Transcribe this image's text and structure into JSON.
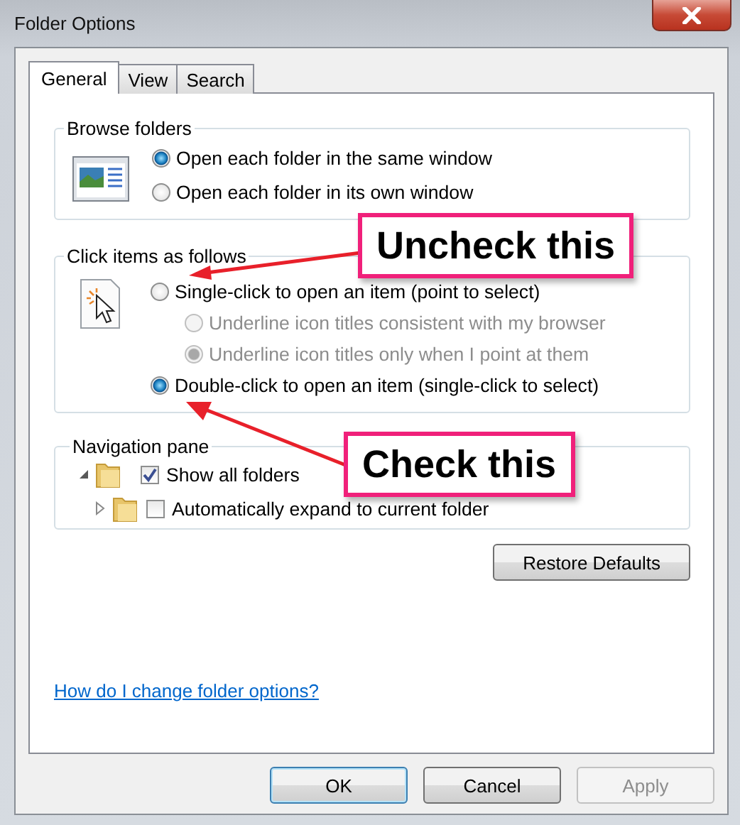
{
  "window": {
    "title": "Folder Options"
  },
  "tabs": [
    {
      "label": "General",
      "selected": true
    },
    {
      "label": "View",
      "selected": false
    },
    {
      "label": "Search",
      "selected": false
    }
  ],
  "browse_folders": {
    "title": "Browse folders",
    "options": [
      {
        "label": "Open each folder in the same window",
        "selected": true
      },
      {
        "label": "Open each folder in its own window",
        "selected": false
      }
    ]
  },
  "click_items": {
    "title": "Click items as follows",
    "options": [
      {
        "label": "Single-click to open an item (point to select)",
        "selected": false,
        "disabled": false,
        "sub": false
      },
      {
        "label": "Underline icon titles consistent with my browser",
        "selected": false,
        "disabled": true,
        "sub": true
      },
      {
        "label": "Underline icon titles only when I point at them",
        "selected": true,
        "disabled": true,
        "sub": true
      },
      {
        "label": "Double-click to open an item (single-click to select)",
        "selected": true,
        "disabled": false,
        "sub": false
      }
    ]
  },
  "navigation_pane": {
    "title": "Navigation pane",
    "options": [
      {
        "label": "Show all folders",
        "checked": true
      },
      {
        "label": "Automatically expand to current folder",
        "checked": false
      }
    ]
  },
  "restore_button": "Restore Defaults",
  "help_link": "How do I change folder options?",
  "buttons": [
    {
      "label": "OK",
      "default": true,
      "disabled": false
    },
    {
      "label": "Cancel",
      "default": false,
      "disabled": false
    },
    {
      "label": "Apply",
      "default": false,
      "disabled": true
    }
  ],
  "annotations": [
    {
      "text": "Uncheck this"
    },
    {
      "text": "Check this"
    }
  ]
}
